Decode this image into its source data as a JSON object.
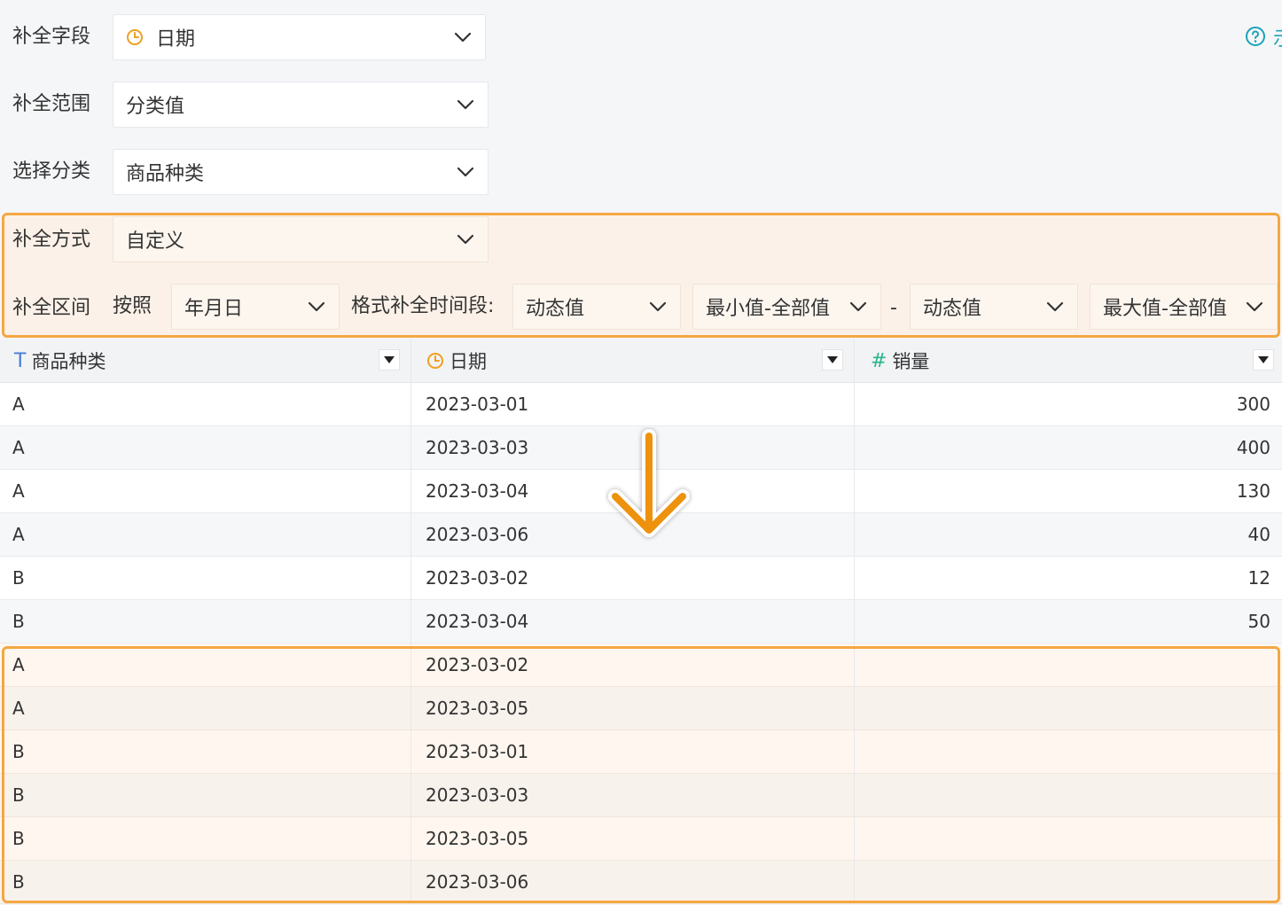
{
  "form": {
    "fill_field": {
      "label": "补全字段",
      "value": "日期",
      "icon": "clock-icon"
    },
    "fill_scope": {
      "label": "补全范围",
      "value": "分类值"
    },
    "select_category": {
      "label": "选择分类",
      "value": "商品种类"
    },
    "fill_method": {
      "label": "补全方式",
      "value": "自定义"
    },
    "fill_range": {
      "label": "补全区间",
      "by_label": "按照",
      "granularity": "年月日",
      "format_label": "格式补全时间段:",
      "start_type": "动态值",
      "start_value": "最小值-全部值",
      "separator": "-",
      "end_type": "动态值",
      "end_value": "最大值-全部值"
    },
    "help_text": "示"
  },
  "colors": {
    "accent": "#f5a742",
    "arrow": "#ee9211",
    "clock": "#f0a020",
    "number_type": "#2bb58e",
    "text_type": "#4a7cd6",
    "help": "#1aa3b8"
  },
  "table": {
    "columns": [
      {
        "label": "商品种类",
        "type_icon": "T"
      },
      {
        "label": "日期",
        "type_icon": "clock-icon"
      },
      {
        "label": "销量",
        "type_icon": "#"
      }
    ],
    "rows": [
      [
        "A",
        "2023-03-01",
        "300"
      ],
      [
        "A",
        "2023-03-03",
        "400"
      ],
      [
        "A",
        "2023-03-04",
        "130"
      ],
      [
        "A",
        "2023-03-06",
        "40"
      ],
      [
        "B",
        "2023-03-02",
        "12"
      ],
      [
        "B",
        "2023-03-04",
        "50"
      ]
    ],
    "filled_rows": [
      [
        "A",
        "2023-03-02",
        ""
      ],
      [
        "A",
        "2023-03-05",
        ""
      ],
      [
        "B",
        "2023-03-01",
        ""
      ],
      [
        "B",
        "2023-03-03",
        ""
      ],
      [
        "B",
        "2023-03-05",
        ""
      ],
      [
        "B",
        "2023-03-06",
        ""
      ]
    ]
  }
}
